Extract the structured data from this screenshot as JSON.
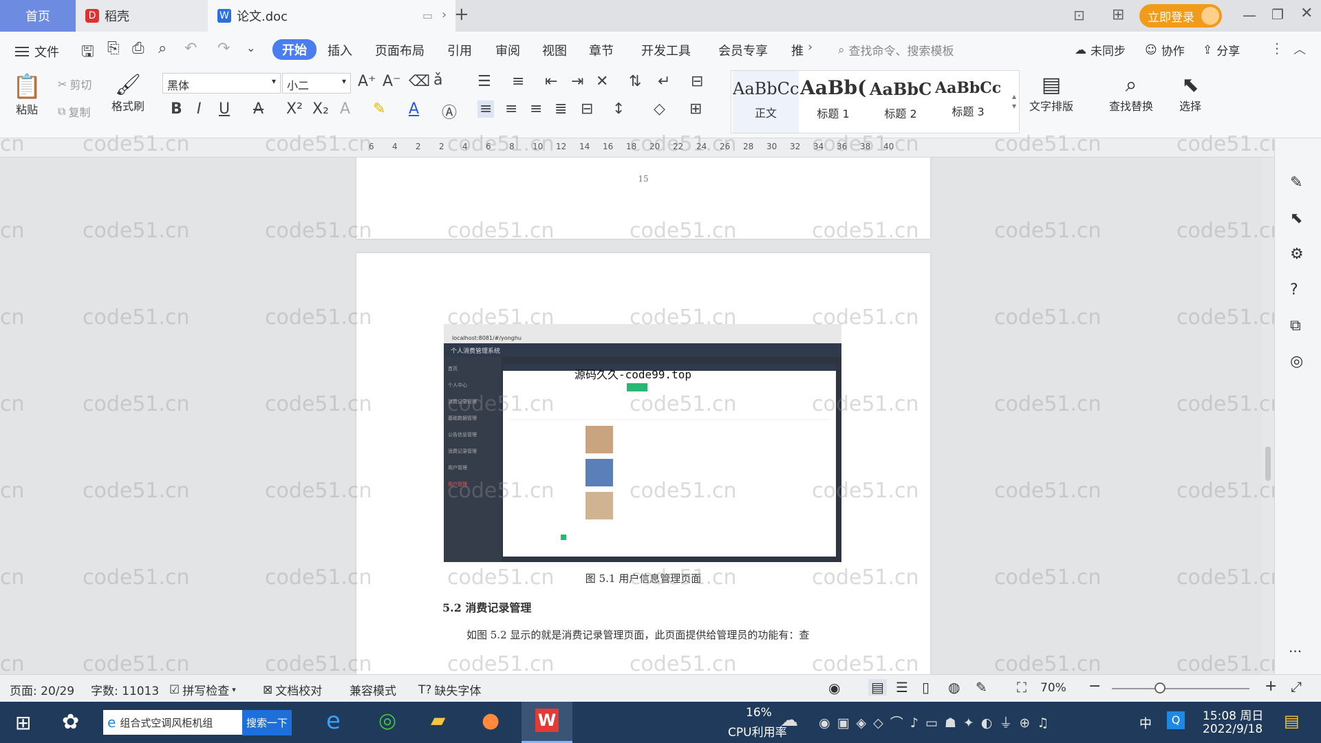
{
  "tabs": {
    "home": "首页",
    "docer": "稻壳",
    "doc": "论文.doc",
    "login": "立即登录"
  },
  "menu": {
    "file": "文件",
    "items": [
      "开始",
      "插入",
      "页面布局",
      "引用",
      "审阅",
      "视图",
      "章节",
      "开发工具",
      "会员专享",
      "推"
    ],
    "search": "查找命令、搜索模板",
    "sync": "未同步",
    "collab": "协作",
    "share": "分享"
  },
  "ribbon": {
    "paste": "粘贴",
    "cut": "剪切",
    "copy": "复制",
    "format_painter": "格式刷",
    "font": "黑体",
    "size": "小二",
    "styles": [
      {
        "preview": "AaBbCcI",
        "label": "正文"
      },
      {
        "preview": "AaBb(",
        "label": "标题 1"
      },
      {
        "preview": "AaBbC",
        "label": "标题 2"
      },
      {
        "preview": "AaBbCcl",
        "label": "标题 3"
      }
    ],
    "text_layout": "文字排版",
    "find_replace": "查找替换",
    "select": "选择"
  },
  "ruler": {
    "ticks": [
      "6",
      "4",
      "2",
      "2",
      "4",
      "6",
      "8",
      "10",
      "12",
      "14",
      "16",
      "18",
      "20",
      "22",
      "24",
      "26",
      "28",
      "30",
      "32",
      "34",
      "36",
      "38",
      "40"
    ]
  },
  "document": {
    "page_number": "15",
    "overlay": "源码久久-code99.top",
    "caption": "图 5.1 用户信息管理页面",
    "heading": "5.2  消费记录管理",
    "paragraph": "如图 5.2 显示的就是消费记录管理页面，此页面提供给管理员的功能有：查",
    "watermark": "code51.cn",
    "screenshot": {
      "app_title": "个人消费管理系统",
      "url": "localhost:8081/#/yonghu",
      "nav": [
        "首页",
        "个人中心",
        "消费记录管理",
        "基础数据管理",
        "公告信息管理",
        "消费记录管理",
        "用户管理",
        "用户管理"
      ]
    }
  },
  "status": {
    "page": "页面: 20/29",
    "words": "字数: 11013",
    "spell": "拼写检查",
    "proof": "文档校对",
    "compat": "兼容模式",
    "missing_font": "缺失字体",
    "zoom": "70%"
  },
  "taskbar": {
    "search_text": "组合式空调风柜机组",
    "search_btn": "搜索一下",
    "cpu_pct": "16%",
    "cpu_label": "CPU利用率",
    "ime": "中",
    "time": "15:08 周日",
    "date": "2022/9/18"
  }
}
